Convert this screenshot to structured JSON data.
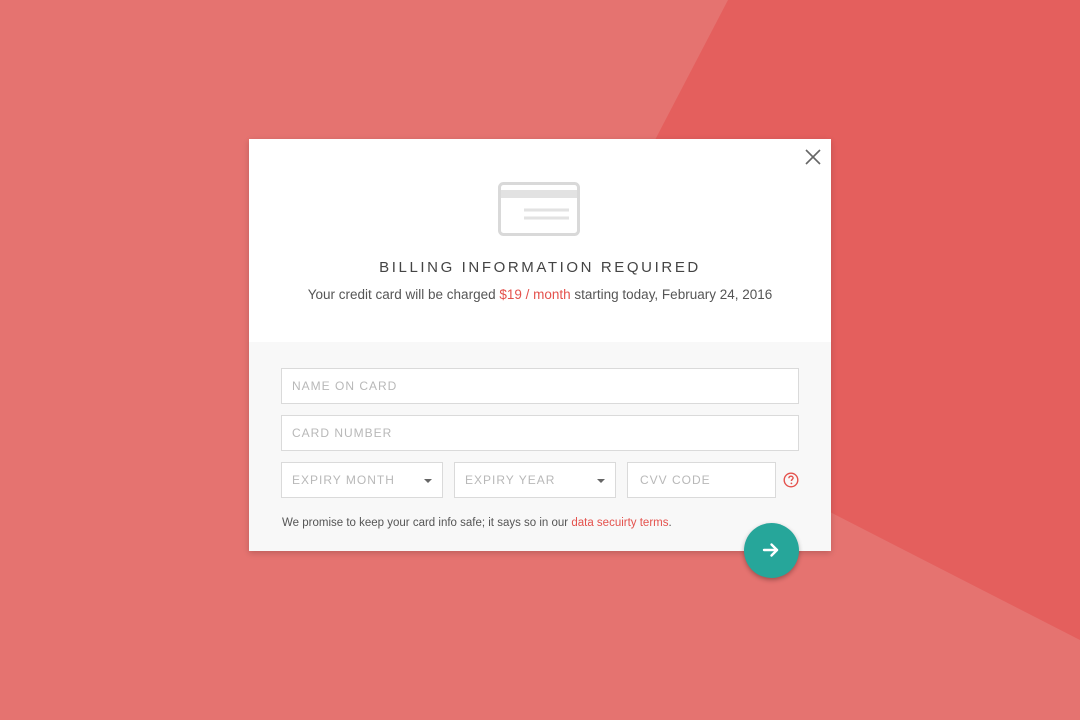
{
  "colors": {
    "background": "#e57370",
    "background_shape": "#e45f5d",
    "accent": "#e4524d",
    "submit": "#26a69a"
  },
  "modal": {
    "close_icon": "close-icon",
    "card_icon": "credit-card-icon",
    "title": "BILLING INFORMATION REQUIRED",
    "subtitle_prefix": "Your credit card will be charged ",
    "price": "$19 / month",
    "subtitle_suffix": " starting today, February 24, 2016"
  },
  "form": {
    "name_placeholder": "NAME ON CARD",
    "card_number_placeholder": "CARD NUMBER",
    "expiry_month": "EXPIRY MONTH",
    "expiry_year": "EXPIRY YEAR",
    "cvv_placeholder": "CVV CODE",
    "help_icon": "question-circle-icon",
    "promise_text": "We promise to keep your card info safe; it says so in our ",
    "promise_link": "data secuirty terms",
    "promise_end": ".",
    "submit_icon": "arrow-right-icon"
  }
}
